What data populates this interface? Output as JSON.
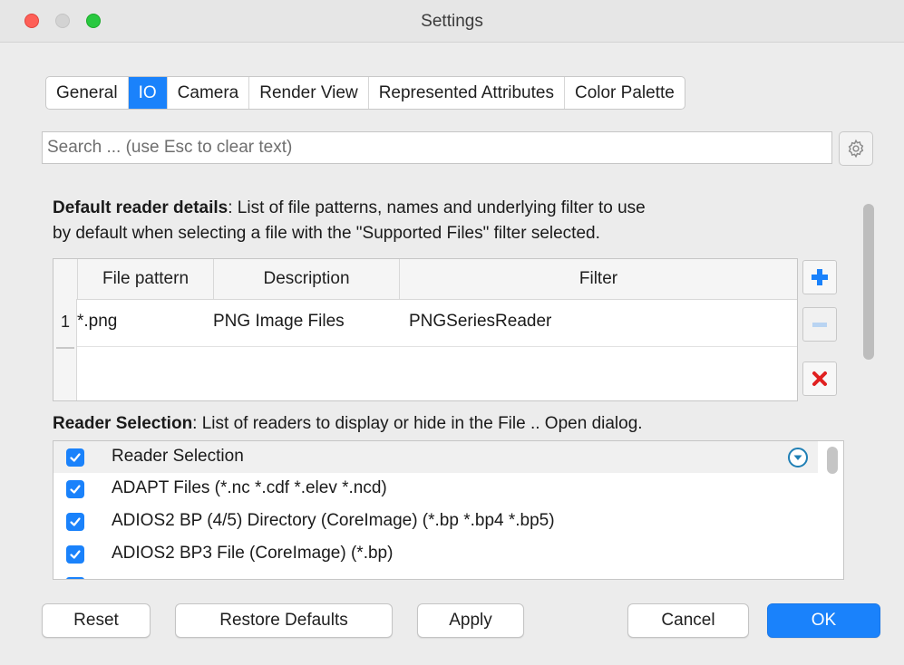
{
  "window": {
    "title": "Settings"
  },
  "tabs": [
    {
      "label": "General",
      "active": false
    },
    {
      "label": "IO",
      "active": true
    },
    {
      "label": "Camera",
      "active": false
    },
    {
      "label": "Render View",
      "active": false
    },
    {
      "label": "Represented Attributes",
      "active": false
    },
    {
      "label": "Color Palette",
      "active": false
    }
  ],
  "search": {
    "placeholder": "Search ... (use Esc to clear text)",
    "value": ""
  },
  "default_reader": {
    "heading": "Default reader details",
    "description_line1": ": List of file patterns, names and underlying filter to use",
    "description_line2": "by default when selecting a file with the \"Supported Files\" filter selected.",
    "columns": [
      "File pattern",
      "Description",
      "Filter"
    ],
    "rows": [
      {
        "num": "1",
        "pattern": "*.png",
        "description": "PNG Image Files",
        "filter": "PNGSeriesReader"
      }
    ]
  },
  "reader_selection": {
    "heading": "Reader Selection",
    "description": ": List of readers to display or hide in the File .. Open dialog.",
    "header_label": "Reader Selection",
    "items": [
      "ADAPT Files (*.nc *.cdf *.elev *.ncd)",
      "ADIOS2 BP (4/5) Directory (CoreImage) (*.bp *.bp4 *.bp5)",
      "ADIOS2 BP3 File (CoreImage) (*.bp)"
    ]
  },
  "buttons": {
    "reset": "Reset",
    "restore_defaults": "Restore Defaults",
    "apply": "Apply",
    "cancel": "Cancel",
    "ok": "OK"
  },
  "colors": {
    "accent": "#1a82fb",
    "add": "#1a82fb",
    "remove_all": "#e02020"
  }
}
